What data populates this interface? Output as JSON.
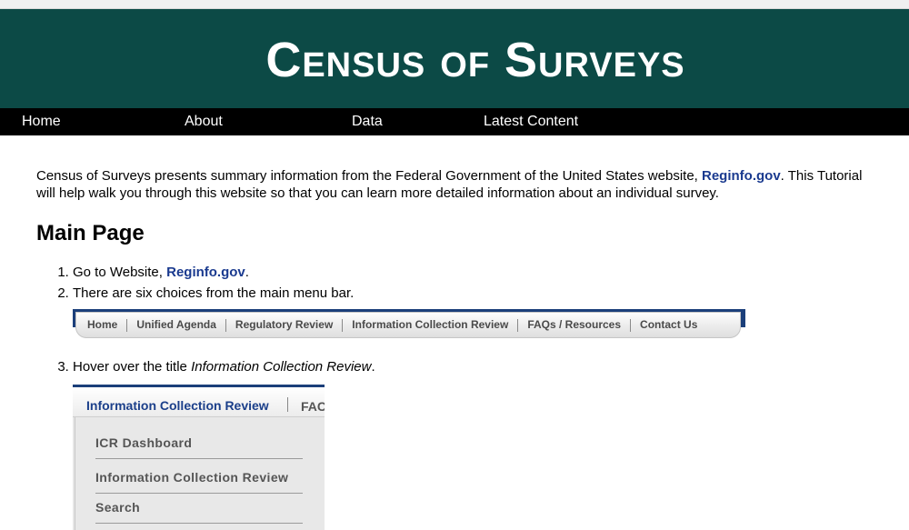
{
  "site": {
    "title": "Census of Surveys"
  },
  "nav": {
    "items": [
      "Home",
      "About",
      "Data",
      "Latest Content"
    ]
  },
  "intro": {
    "text_before": "Census of Surveys presents summary information from the Federal Government of the United States website, ",
    "link": "Reginfo.gov",
    "text_after": ". This Tutorial will help walk you through this website so that you can learn more detailed information about an individual survey."
  },
  "main_page": {
    "heading": "Main Page",
    "step1_prefix": "Go to Website, ",
    "step1_link": "Reginfo.gov",
    "step1_suffix": ".",
    "step2": "There are six choices from the main menu bar.",
    "step3_prefix": "Hover over the title ",
    "step3_em": "Information Collection Review",
    "step3_suffix": "."
  },
  "menu_screenshot": {
    "items": [
      "Home",
      "Unified Agenda",
      "Regulatory Review",
      "Information Collection Review",
      "FAQs / Resources",
      "Contact Us"
    ]
  },
  "dropdown_screenshot": {
    "header": "Information Collection Review",
    "next_tab_partial": "FAC",
    "items": [
      "ICR Dashboard",
      "Information Collection Review",
      "Search"
    ]
  },
  "colors": {
    "banner": "#0c4a46",
    "nav": "#000000",
    "link": "#1a3a8f",
    "reginfo_blue": "#1b3f7a"
  }
}
